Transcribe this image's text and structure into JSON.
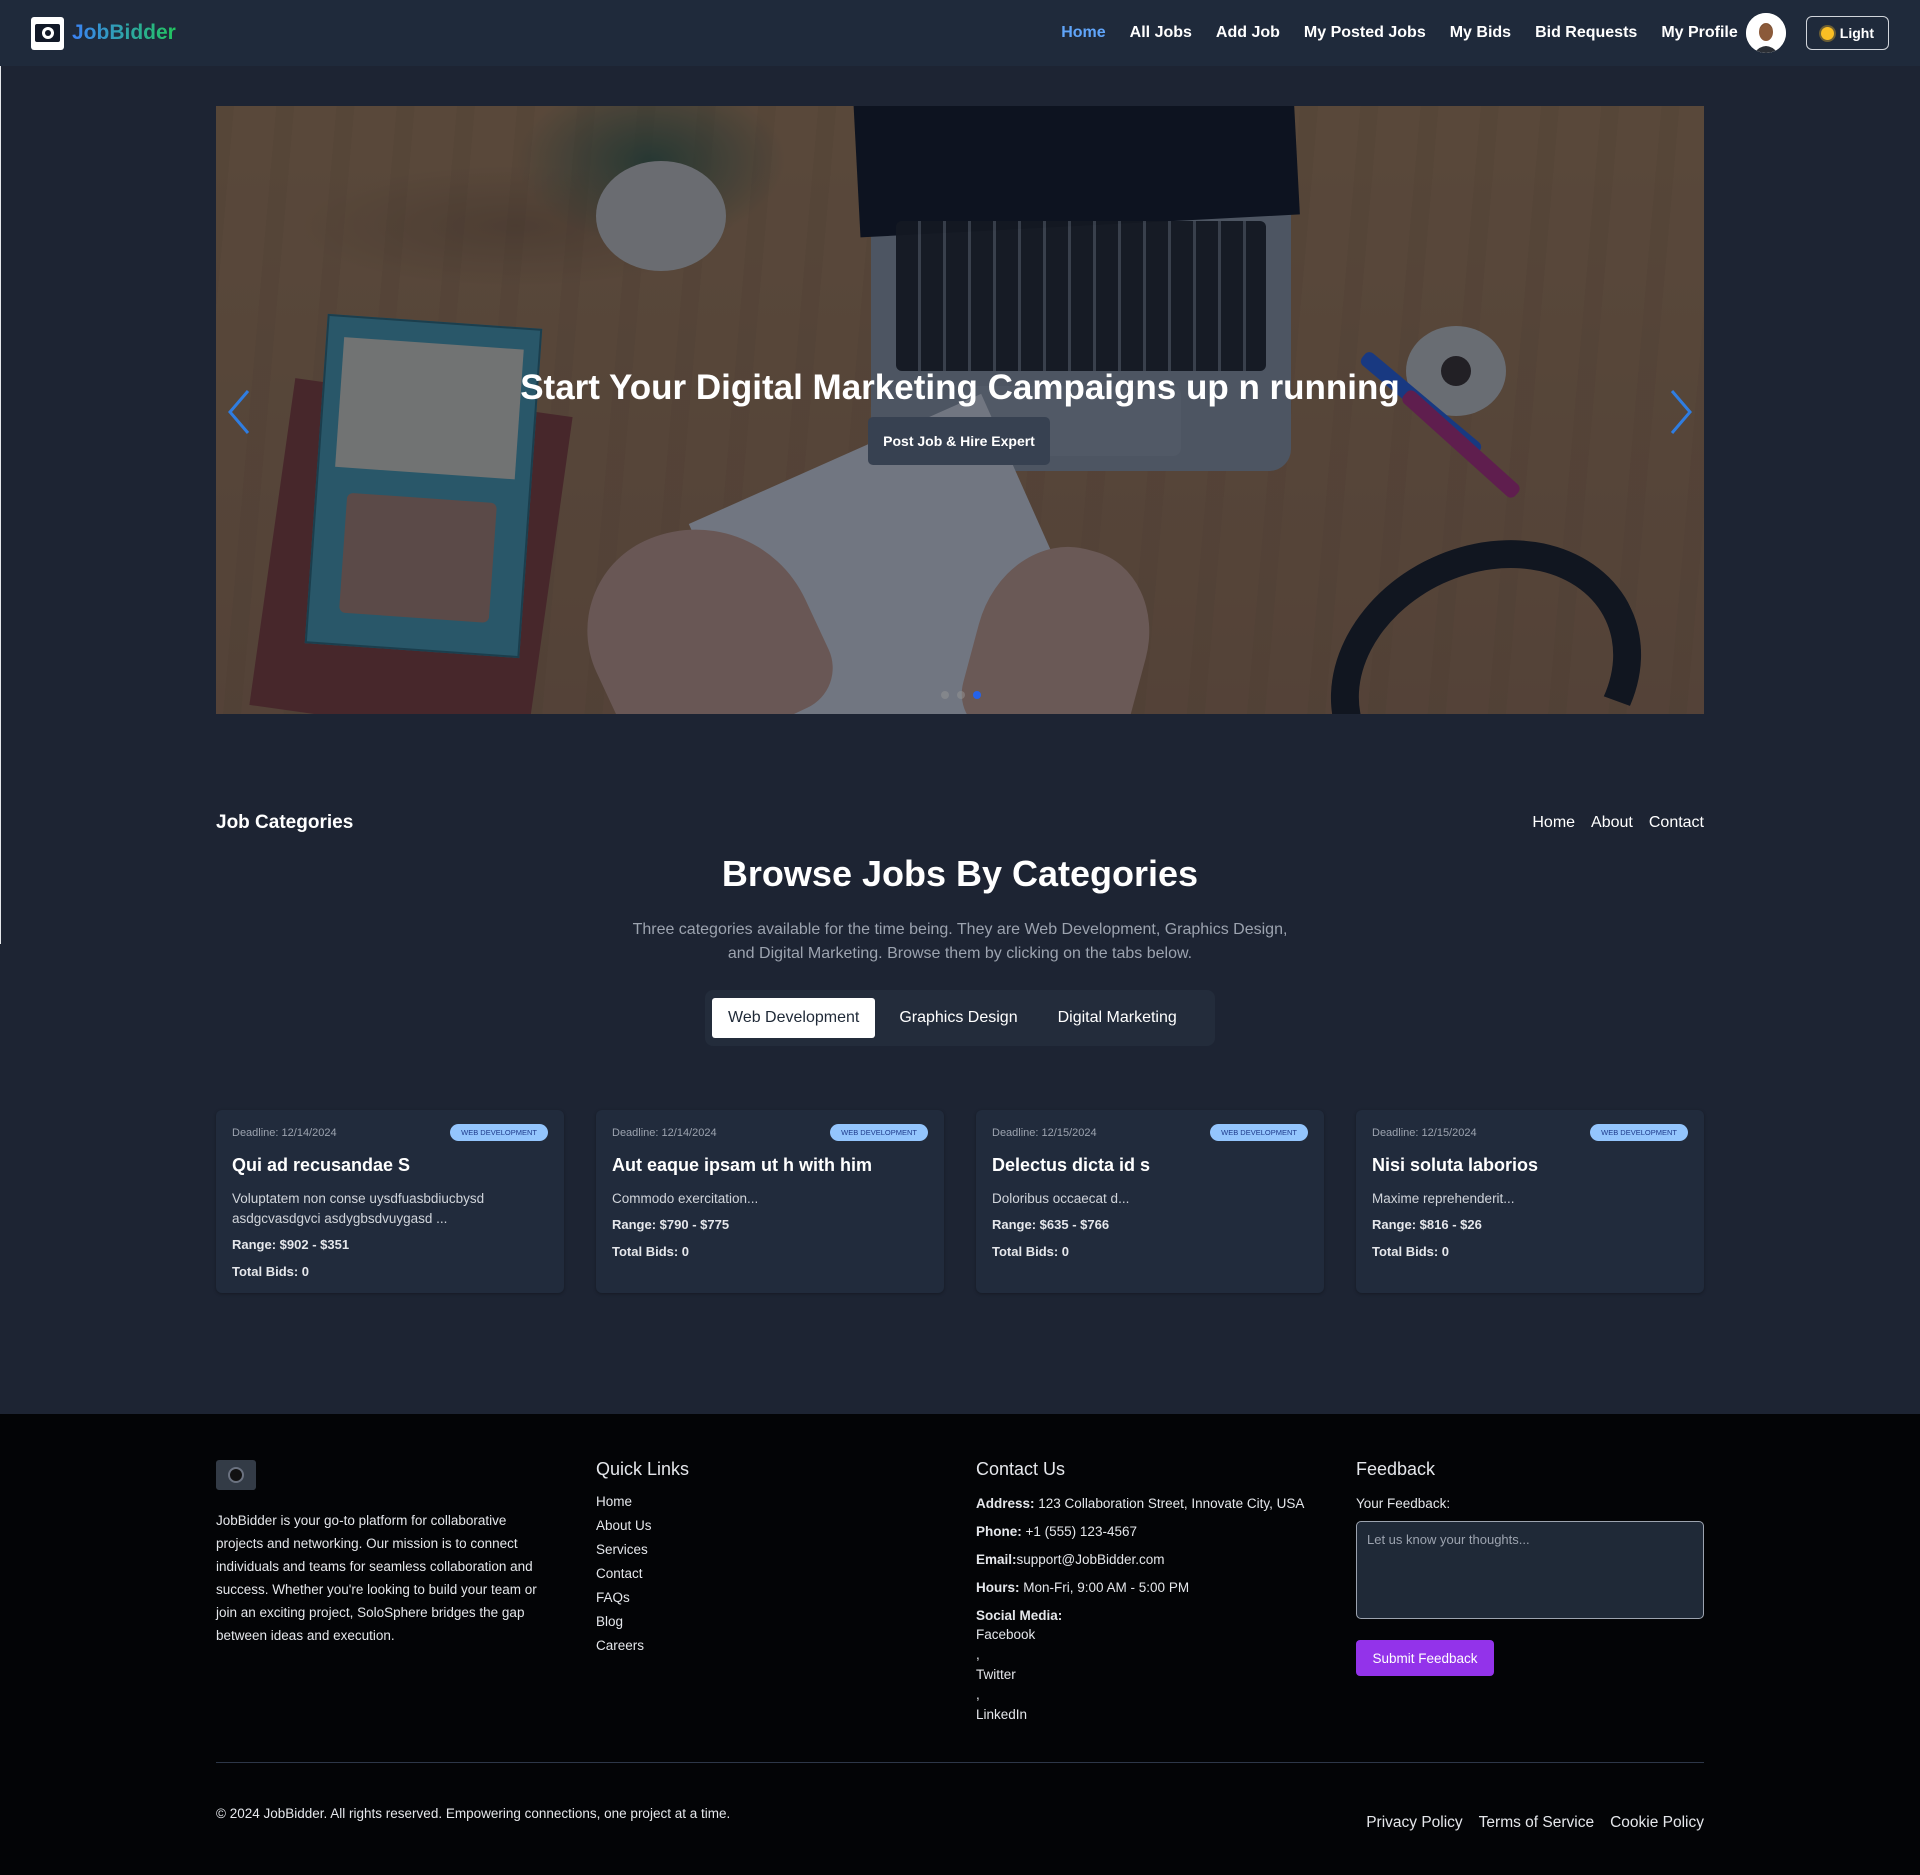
{
  "navbar": {
    "brand": "JobBidder",
    "links": [
      "Home",
      "All Jobs",
      "Add Job",
      "My Posted Jobs",
      "My Bids",
      "Bid Requests",
      "My Profile"
    ],
    "active_link": "Home",
    "theme_label": "Light"
  },
  "hero": {
    "title": "Start Your Digital Marketing Campaigns up n running",
    "button_label": "Post Job & Hire Expert",
    "slide_count": 3,
    "active_slide": 3
  },
  "categories": {
    "section_title": "Job Categories",
    "links": [
      "Home",
      "About",
      "Contact"
    ],
    "heading": "Browse Jobs By Categories",
    "description": "Three categories available for the time being. They are Web Development, Graphics Design, and Digital Marketing. Browse them by clicking on the tabs below.",
    "tabs": [
      "Web Development",
      "Graphics Design",
      "Digital Marketing"
    ],
    "active_tab": "Web Development"
  },
  "jobs": [
    {
      "deadline": "Deadline: 12/14/2024",
      "badge": "WEB DEVELOPMENT",
      "title": "Qui ad recusandae S",
      "desc": "Voluptatem non conse uysdfuasbdiucbysd asdgcvasdgvci asdygbsdvuygasd ...",
      "range": "Range: $902 - $351",
      "bids": "Total Bids: 0"
    },
    {
      "deadline": "Deadline: 12/14/2024",
      "badge": "WEB DEVELOPMENT",
      "title": "Aut eaque ipsam ut h with him",
      "desc": "Commodo exercitation...",
      "range": "Range: $790 - $775",
      "bids": "Total Bids: 0"
    },
    {
      "deadline": "Deadline: 12/15/2024",
      "badge": "WEB DEVELOPMENT",
      "title": "Delectus dicta id s",
      "desc": "Doloribus occaecat d...",
      "range": "Range: $635 - $766",
      "bids": "Total Bids: 0"
    },
    {
      "deadline": "Deadline: 12/15/2024",
      "badge": "WEB DEVELOPMENT",
      "title": "Nisi soluta laborios",
      "desc": "Maxime reprehenderit...",
      "range": "Range: $816 - $26",
      "bids": "Total Bids: 0"
    }
  ],
  "footer": {
    "about": "JobBidder is your go-to platform for collaborative projects and networking. Our mission is to connect individuals and teams for seamless collaboration and success. Whether you're looking to build your team or join an exciting project, SoloSphere bridges the gap between ideas and execution.",
    "quick_links_title": "Quick Links",
    "quick_links": [
      "Home",
      "About Us",
      "Services",
      "Contact",
      "FAQs",
      "Blog",
      "Careers"
    ],
    "contact_title": "Contact Us",
    "address_label": "Address:",
    "address": "123 Collaboration Street, Innovate City, USA",
    "phone_label": "Phone:",
    "phone": "+1 (555) 123-4567",
    "email_label": "Email:",
    "email": "support@JobBidder.com",
    "hours_label": "Hours:",
    "hours": "Mon-Fri, 9:00 AM - 5:00 PM",
    "social_label": "Social Media:",
    "social": [
      "Facebook",
      ",",
      "Twitter",
      ",",
      "LinkedIn"
    ],
    "feedback_title": "Feedback",
    "feedback_label": "Your Feedback:",
    "feedback_placeholder": "Let us know your thoughts...",
    "submit_label": "Submit Feedback",
    "copyright": "© 2024 JobBidder. All rights reserved. Empowering connections, one project at a time.",
    "legal": [
      "Privacy Policy",
      "Terms of Service",
      "Cookie Policy"
    ]
  }
}
